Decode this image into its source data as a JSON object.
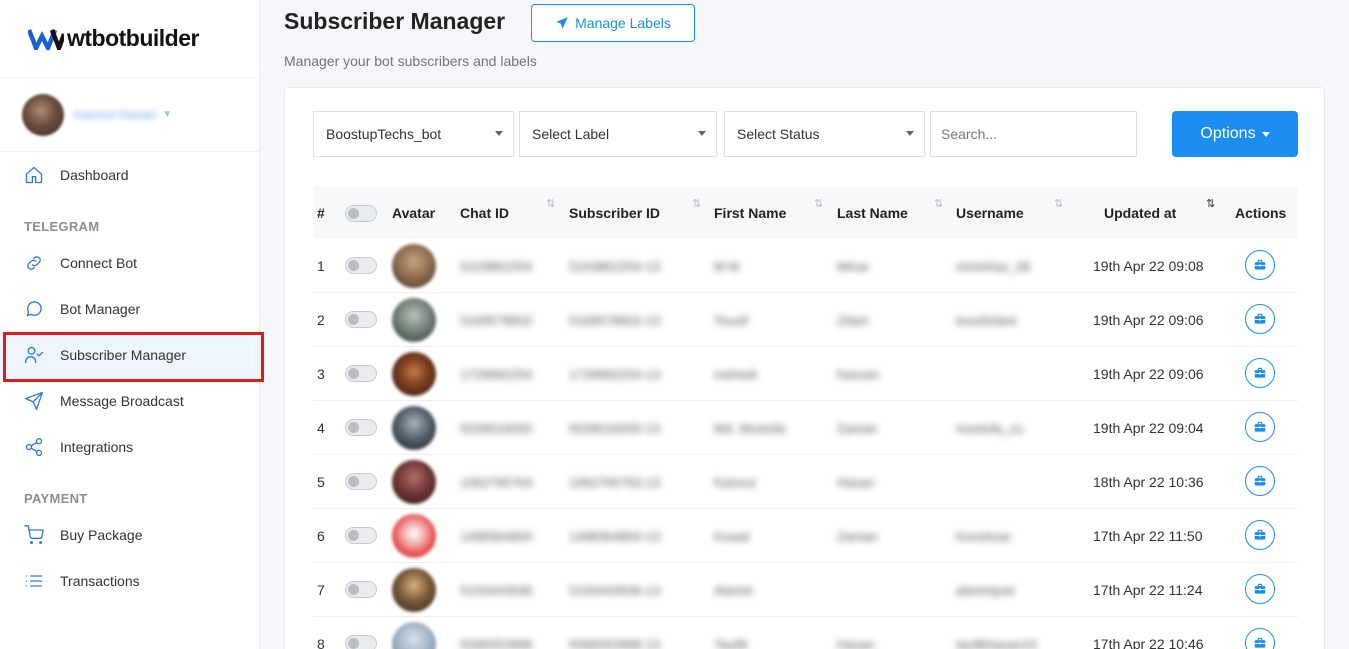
{
  "brand": {
    "name": "wtbotbuilder"
  },
  "user": {
    "name": "Kamrul Hasan"
  },
  "nav": {
    "dashboard": "Dashboard",
    "section_telegram": "TELEGRAM",
    "connect_bot": "Connect Bot",
    "bot_manager": "Bot Manager",
    "subscriber_manager": "Subscriber Manager",
    "message_broadcast": "Message Broadcast",
    "integrations": "Integrations",
    "section_payment": "PAYMENT",
    "buy_package": "Buy Package",
    "transactions": "Transactions"
  },
  "header": {
    "title": "Subscriber Manager",
    "manage_labels": "Manage Labels",
    "subtitle": "Manager your bot subscribers and labels"
  },
  "filters": {
    "bot": "BoostupTechs_bot",
    "label": "Select Label",
    "status": "Select Status",
    "search_placeholder": "Search...",
    "options": "Options"
  },
  "table": {
    "columns": {
      "num": "#",
      "avatar": "Avatar",
      "chat_id": "Chat ID",
      "subscriber_id": "Subscriber ID",
      "first_name": "First Name",
      "last_name": "Last Name",
      "username": "Username",
      "updated_at": "Updated at",
      "actions": "Actions"
    },
    "rows": [
      {
        "num": "1",
        "chat_id": "5103861554",
        "subscriber_id": "5103861554-13",
        "first_name": "M M",
        "last_name": "Minar",
        "username": "mminhaz_06",
        "updated_at": "19th Apr 22 09:08"
      },
      {
        "num": "2",
        "chat_id": "5169578602",
        "subscriber_id": "5169578602-13",
        "first_name": "Tousif",
        "last_name": "Zilani",
        "username": "tousifzilani",
        "updated_at": "19th Apr 22 09:06"
      },
      {
        "num": "3",
        "chat_id": "1729992254",
        "subscriber_id": "1729992254-13",
        "first_name": "mehedi",
        "last_name": "hassan",
        "username": "",
        "updated_at": "19th Apr 22 09:06"
      },
      {
        "num": "4",
        "chat_id": "5028016050",
        "subscriber_id": "5028016050-13",
        "first_name": "Md. Mostofa",
        "last_name": "Zaman",
        "username": "mostofa_zu",
        "updated_at": "19th Apr 22 09:04"
      },
      {
        "num": "5",
        "chat_id": "1062795763",
        "subscriber_id": "1062795763-13",
        "first_name": "Kamrul",
        "last_name": "Hasan",
        "username": "",
        "updated_at": "18th Apr 22 10:36"
      },
      {
        "num": "6",
        "chat_id": "1498364800",
        "subscriber_id": "1498364800-13",
        "first_name": "Kowal",
        "last_name": "Zaman",
        "username": "Konokzar",
        "updated_at": "17th Apr 22 11:50"
      },
      {
        "num": "7",
        "chat_id": "5150443936",
        "subscriber_id": "5150443936-13",
        "first_name": "Alamin",
        "last_name": "",
        "username": "alaminjuel",
        "updated_at": "17th Apr 22 11:24"
      },
      {
        "num": "8",
        "chat_id": "5068352898",
        "subscriber_id": "5068352898-13",
        "first_name": "Taufik",
        "last_name": "Hasan",
        "username": "taufikhasan10",
        "updated_at": "17th Apr 22 10:46"
      }
    ]
  },
  "colors": {
    "accent": "#1b8ef0",
    "highlight": "#e11b1b"
  }
}
